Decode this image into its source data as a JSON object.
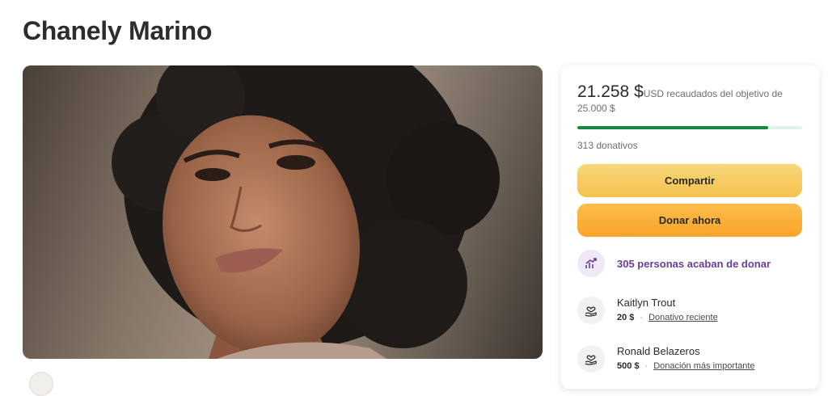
{
  "page": {
    "title": "Chanely Marino"
  },
  "campaign": {
    "raised_amount": "21.258 $",
    "raised_text": "USD recaudados del objetivo de 25.000 $",
    "progress_fraction": 0.85,
    "donations_count": "313 donativos",
    "share_label": "Compartir",
    "donate_label": "Donar ahora",
    "recent_donors_label": "305 personas acaban de donar"
  },
  "donors": [
    {
      "name": "Kaitlyn Trout",
      "amount": "20 $",
      "tag": "Donativo reciente"
    },
    {
      "name": "Ronald Belazeros",
      "amount": "500 $",
      "tag": "Donación más importante"
    }
  ],
  "colors": {
    "progress": "#12893f",
    "accent_purple": "#6a3d9a",
    "share_button": "#f4c24f",
    "donate_button": "#f9a42b"
  },
  "icons": [
    "trend-up-icon",
    "heart-hand-icon",
    "heart-hand-icon"
  ]
}
